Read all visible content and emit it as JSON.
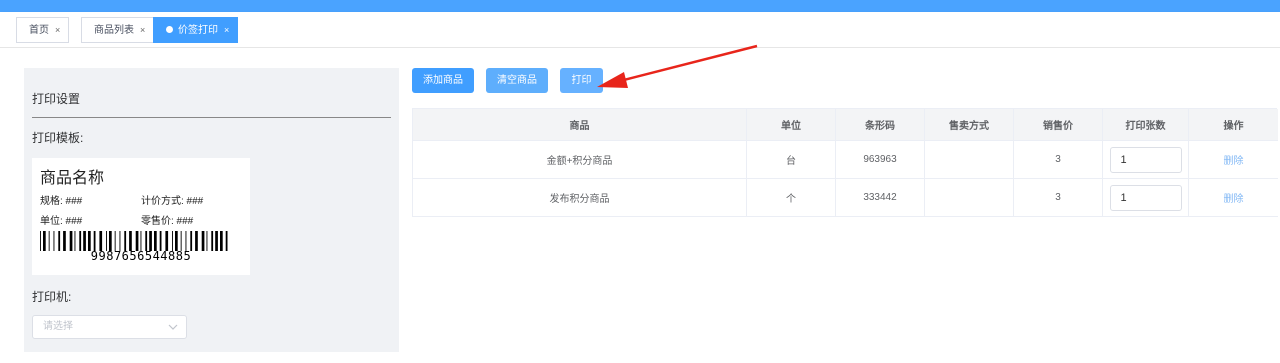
{
  "tabs": [
    {
      "label": "首页",
      "close": "×"
    },
    {
      "label": "商品列表",
      "close": "×"
    },
    {
      "label": "价签打印",
      "close": "×",
      "active": true
    }
  ],
  "settings": {
    "title": "打印设置",
    "template_label": "打印模板:",
    "label_preview": {
      "product_name": "商品名称",
      "spec": "规格: ###",
      "pricing": "计价方式: ###",
      "unit": "单位: ###",
      "retail_price": "零售价: ###",
      "barcode_number": "9987656544885"
    },
    "printer_label": "打印机:",
    "printer_select": {
      "placeholder": "请选择",
      "icon": "chevron-down-icon"
    }
  },
  "toolbar": {
    "add_label": "添加商品",
    "clear_label": "清空商品",
    "print_label": "打印"
  },
  "table": {
    "headers": [
      "商品",
      "单位",
      "条形码",
      "售卖方式",
      "销售价",
      "打印张数",
      "操作"
    ],
    "rows": [
      {
        "product": "金额+积分商品",
        "unit": "台",
        "barcode": "963963",
        "sale_mode": "",
        "price": "3",
        "print_count": "1",
        "action": "删除"
      },
      {
        "product": "发布积分商品",
        "unit": "个",
        "barcode": "333442",
        "sale_mode": "",
        "price": "3",
        "print_count": "1",
        "action": "删除"
      }
    ]
  },
  "colors": {
    "primary": "#409eff",
    "annotation_arrow": "#e8251b"
  }
}
